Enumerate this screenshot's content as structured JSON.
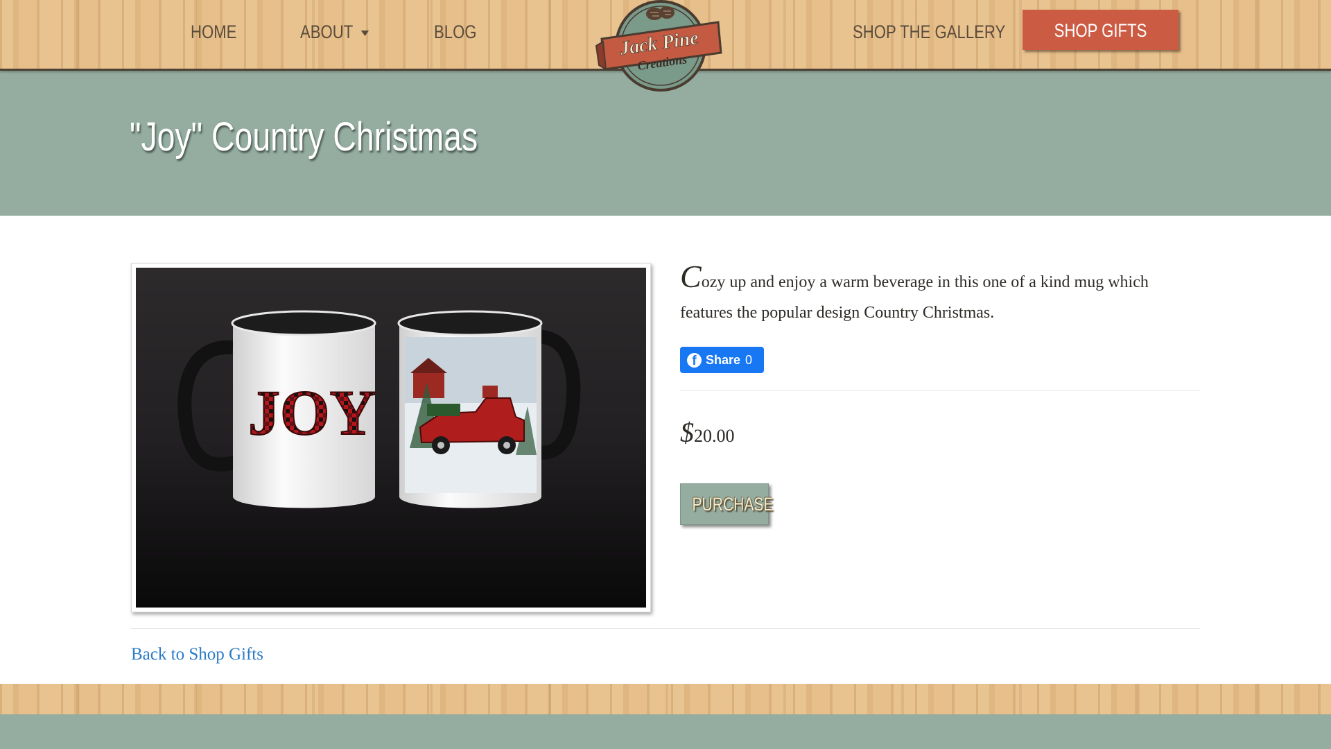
{
  "nav": {
    "home": "HOME",
    "about": "ABOUT",
    "blog": "BLOG",
    "shop_gallery": "SHOP THE GALLERY",
    "shop_gifts": "SHOP GIFTS"
  },
  "logo": {
    "line1": "Jack Pine",
    "line2": "Creations"
  },
  "page": {
    "title": "\"Joy\" Country Christmas"
  },
  "product": {
    "image_text": "JOY",
    "description_first_letter": "C",
    "description_rest": "ozy up and enjoy a warm beverage in this one of a kind mug which features the popular design Country Christmas.",
    "share_label": "Share",
    "share_count": "0",
    "price_symbol": "$",
    "price_value": "20.00",
    "purchase_label": "PURCHASE"
  },
  "back_link": "Back to Shop Gifts",
  "colors": {
    "hero_green": "#94ada0",
    "accent_red": "#cc5b44",
    "wood": "#e6bf8a",
    "link_blue": "#2a7ac6",
    "facebook_blue": "#1877f2"
  },
  "icons": [
    "pinecone-icon",
    "facebook-icon",
    "caret-down-icon"
  ]
}
